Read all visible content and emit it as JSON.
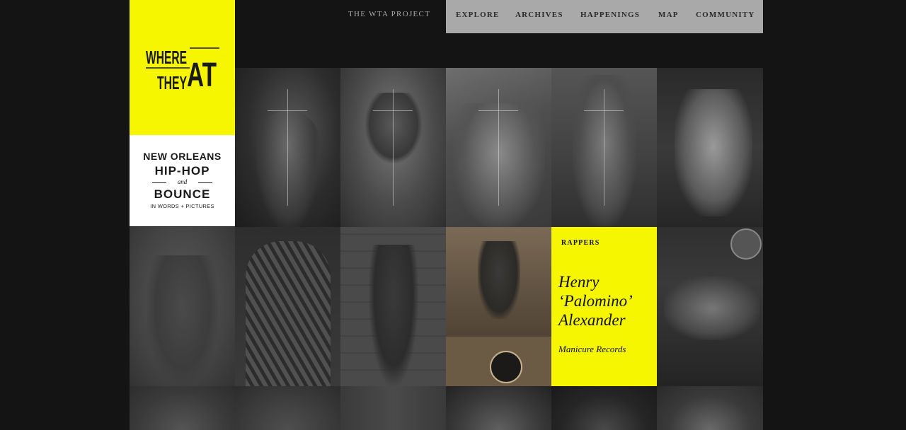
{
  "nav": {
    "project": "THE WTA PROJECT",
    "items": [
      "EXPLORE",
      "ARCHIVES",
      "HAPPENINGS",
      "MAP",
      "COMMUNITY"
    ]
  },
  "logo": {
    "line1": "WHERE",
    "line2": "THEY",
    "line3": "AT"
  },
  "tagline": {
    "line1": "NEW ORLEANS",
    "line2": "HIP-HOP",
    "line3": "and",
    "line4": "BOUNCE",
    "line5": "IN WORDS + PICTURES"
  },
  "feature": {
    "category": "RAPPERS",
    "name": "Henry ‘Palomino’ Alexander",
    "label": "Manicure Records"
  },
  "colors": {
    "background": "#141414",
    "accent_yellow": "#f6f600",
    "nav_gray": "#a9a9a9"
  }
}
